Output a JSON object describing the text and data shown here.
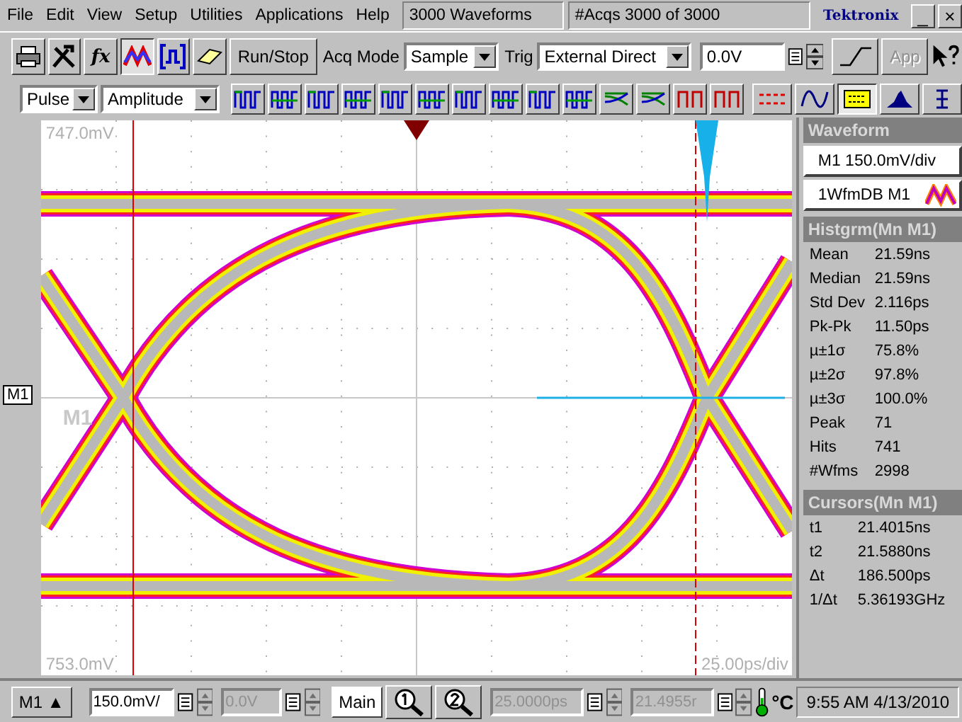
{
  "menu": [
    "File",
    "Edit",
    "View",
    "Setup",
    "Utilities",
    "Applications",
    "Help"
  ],
  "status": {
    "waveforms": "3000 Waveforms",
    "acqs_label": "#Acqs",
    "acqs_value": "3000 of 3000"
  },
  "logo": "Tektronix",
  "window_buttons": [
    "_",
    "×"
  ],
  "toolbar": {
    "tools": [
      {
        "kind": "printer",
        "selected": false
      },
      {
        "kind": "tools",
        "selected": false
      },
      {
        "kind": "function",
        "label": "fx",
        "selected": false
      },
      {
        "kind": "waveform",
        "selected": true
      },
      {
        "kind": "bracket",
        "selected": false
      },
      {
        "kind": "eraser",
        "selected": false
      }
    ],
    "run_stop": "Run/Stop",
    "acq_mode_label": "Acq Mode",
    "acq_mode": "Sample",
    "trig_label": "Trig",
    "trig_source": "External Direct",
    "trig_level": "0.0V",
    "app": {
      "label": "App",
      "disabled": true
    }
  },
  "measure_bar": {
    "type": "Pulse",
    "measurement": "Amplitude",
    "views": [
      {
        "kind": "dashes",
        "selected": false
      },
      {
        "kind": "wave",
        "selected": false
      },
      {
        "kind": "readout",
        "selected": true
      },
      {
        "kind": "histogram",
        "selected": false
      },
      {
        "kind": "bracket",
        "selected": false
      }
    ]
  },
  "plot": {
    "top_label": "747.0mV",
    "bottom_label": "753.0mV",
    "marker": "M1",
    "ref_label": "M1",
    "timebase": "25.00ps/div"
  },
  "panel": {
    "waveform_title": "Waveform",
    "scale": "M1 150.0mV/div",
    "wfmdb": "1WfmDB M1",
    "histogram_title": "Histgrm(Mn M1)",
    "histogram": [
      {
        "label": "Mean",
        "value": "21.59ns"
      },
      {
        "label": "Median",
        "value": "21.59ns"
      },
      {
        "label": "Std Dev",
        "value": "2.116ps"
      },
      {
        "label": "Pk-Pk",
        "value": "11.50ps"
      },
      {
        "label": "µ±1σ",
        "value": "75.8%"
      },
      {
        "label": "µ±2σ",
        "value": "97.8%"
      },
      {
        "label": "µ±3σ",
        "value": "100.0%"
      },
      {
        "label": "Peak",
        "value": "71"
      },
      {
        "label": "Hits",
        "value": "741"
      },
      {
        "label": "#Wfms",
        "value": "2998"
      }
    ],
    "cursors_title": "Cursors(Mn M1)",
    "cursors": [
      {
        "label": "t1",
        "value": "21.4015ns"
      },
      {
        "label": "t2",
        "value": "21.5880ns"
      },
      {
        "label": "Δt",
        "value": "186.500ps"
      },
      {
        "label": "1/Δt",
        "value": "5.36193GHz"
      }
    ]
  },
  "bottom": {
    "channel": "M1",
    "channel_arrow": "▲",
    "scale": {
      "value": "150.0mV/",
      "disabled": false
    },
    "offset": {
      "value": "0.0V",
      "disabled": true
    },
    "timebase_mode": "Main",
    "position": {
      "value": "25.0000ps",
      "disabled": true
    },
    "delay": {
      "value": "21.4955r",
      "disabled": true
    },
    "temp_unit": "°C",
    "clock": "9:55 AM 4/13/2010"
  }
}
